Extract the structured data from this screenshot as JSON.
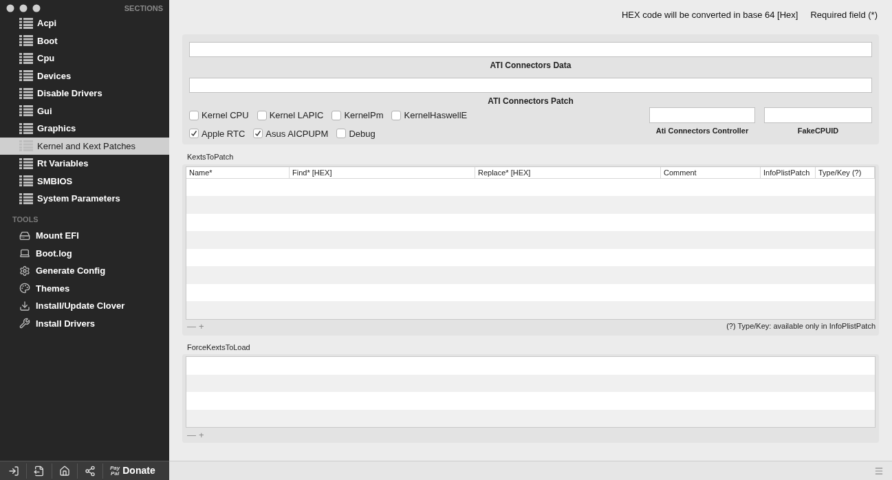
{
  "sidebar": {
    "sections_title": "SECTIONS",
    "sections": [
      {
        "label": "Acpi",
        "selected": false
      },
      {
        "label": "Boot",
        "selected": false
      },
      {
        "label": "Cpu",
        "selected": false
      },
      {
        "label": "Devices",
        "selected": false
      },
      {
        "label": "Disable Drivers",
        "selected": false
      },
      {
        "label": "Gui",
        "selected": false
      },
      {
        "label": "Graphics",
        "selected": false
      },
      {
        "label": "Kernel and Kext Patches",
        "selected": true
      },
      {
        "label": "Rt Variables",
        "selected": false
      },
      {
        "label": "SMBIOS",
        "selected": false
      },
      {
        "label": "System Parameters",
        "selected": false
      }
    ],
    "tools_title": "TOOLS",
    "tools": [
      {
        "label": "Mount EFI",
        "kind": "disk"
      },
      {
        "label": "Boot.log",
        "kind": "log"
      },
      {
        "label": "Generate Config",
        "kind": "gear"
      },
      {
        "label": "Themes",
        "kind": "palette"
      },
      {
        "label": "Install/Update Clover",
        "kind": "download"
      },
      {
        "label": "Install Drivers",
        "kind": "tools"
      }
    ]
  },
  "bottom_bar": {
    "buttons": [
      {
        "kind": "import"
      },
      {
        "kind": "export"
      },
      {
        "kind": "home"
      },
      {
        "kind": "share"
      }
    ],
    "paypal": [
      "Pay",
      "Pal"
    ],
    "donate": "Donate"
  },
  "header": {
    "hex_note": "HEX code will be converted in base 64 [Hex]",
    "required_note": "Required field (*)"
  },
  "ati": {
    "data_label": "ATI Connectors Data",
    "patch_label": "ATI Connectors Patch",
    "checkboxes": [
      [
        {
          "label": "Kernel CPU",
          "checked": false
        },
        {
          "label": "Kernel LAPIC",
          "checked": false
        },
        {
          "label": "KernelPm",
          "checked": false
        },
        {
          "label": "KernelHaswellE",
          "checked": false
        }
      ],
      [
        {
          "label": "Apple RTC",
          "checked": true
        },
        {
          "label": "Asus AICPUPM",
          "checked": true
        },
        {
          "label": "Debug",
          "checked": false
        }
      ]
    ],
    "controller_label": "Ati Connectors Controller",
    "fakecpuid_label": "FakeCPUID"
  },
  "kexts_to_patch": {
    "title": "KextsToPatch",
    "columns": [
      "Name*",
      "Find* [HEX]",
      "Replace* [HEX]",
      "Comment",
      "InfoPlistPatch",
      "Type/Key (?)"
    ],
    "add_remove": [
      "—",
      "+"
    ],
    "note": "(?) Type/Key: available only in InfoPlistPatch"
  },
  "force_kexts_to_load": {
    "title": "ForceKextsToLoad",
    "add_remove": [
      "—",
      "+"
    ]
  }
}
